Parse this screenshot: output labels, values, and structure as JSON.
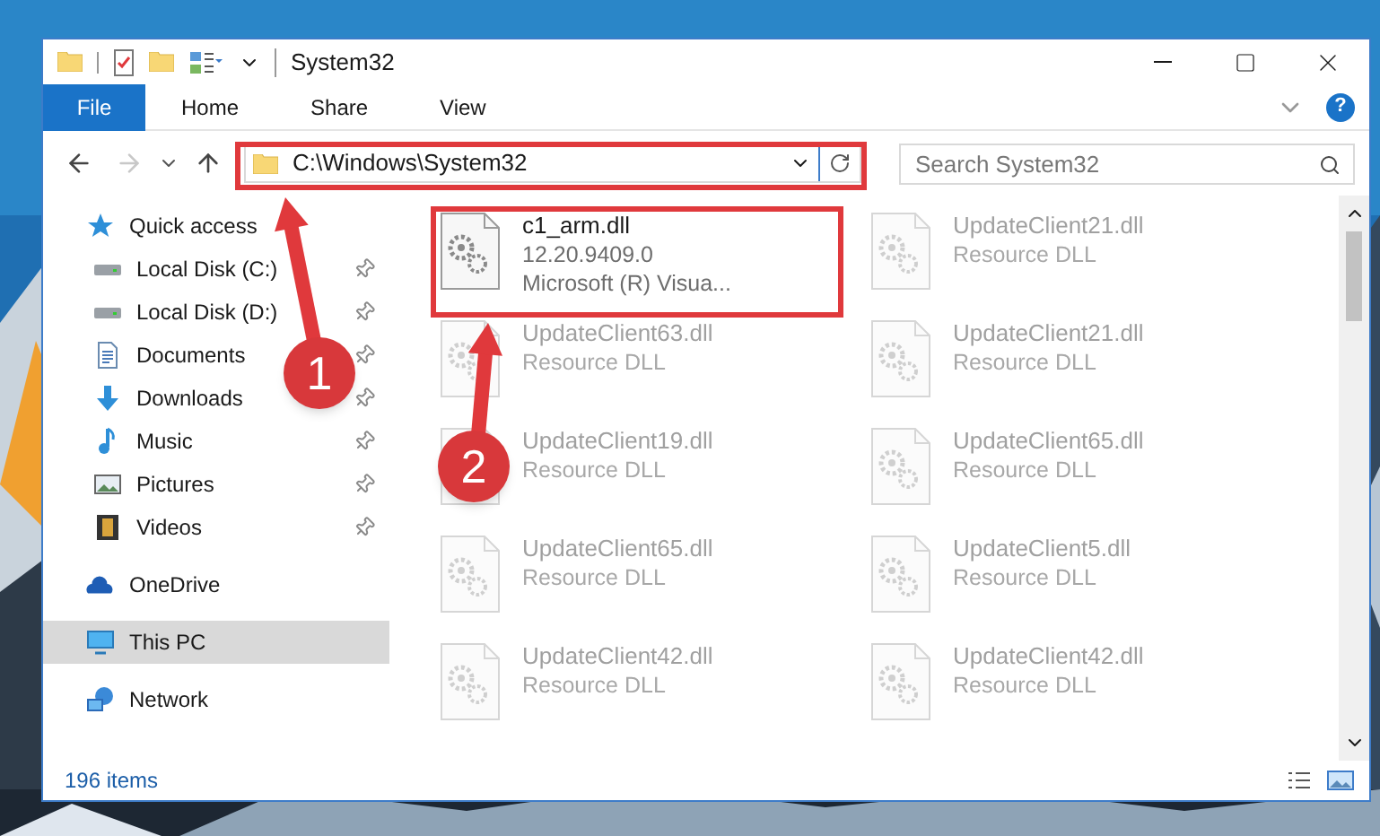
{
  "window": {
    "title": "System32",
    "help": "?"
  },
  "ribbon_tabs": [
    {
      "label": "File",
      "kind": "menu"
    },
    {
      "label": "Home",
      "kind": "tab"
    },
    {
      "label": "Share",
      "kind": "tab"
    },
    {
      "label": "View",
      "kind": "tab"
    }
  ],
  "navigation": {
    "forward_disabled": true
  },
  "address": {
    "path": "C:\\Windows\\System32"
  },
  "search": {
    "placeholder": "Search System32"
  },
  "sidebar": {
    "items": [
      {
        "label": "Quick access",
        "kind": "star",
        "selected": false,
        "children": [
          {
            "label": "Local Disk (C:)",
            "kind": "drive",
            "selected": false,
            "pinned": true
          },
          {
            "label": "Local Disk (D:)",
            "kind": "drive",
            "selected": false,
            "pinned": true
          },
          {
            "label": "Documents",
            "kind": "documents",
            "selected": false,
            "pinned": true
          },
          {
            "label": "Downloads",
            "kind": "downloads",
            "selected": false,
            "pinned": true
          },
          {
            "label": "Music",
            "kind": "music",
            "selected": false,
            "pinned": true
          },
          {
            "label": "Pictures",
            "kind": "pictures",
            "selected": false,
            "pinned": true
          },
          {
            "label": "Videos",
            "kind": "videos",
            "selected": false,
            "pinned": true
          }
        ]
      },
      {
        "label": "OneDrive",
        "kind": "cloud",
        "selected": false
      },
      {
        "label": "This PC",
        "kind": "computer",
        "selected": true
      },
      {
        "label": "Network",
        "kind": "network",
        "selected": false
      }
    ]
  },
  "files": [
    {
      "name": "c1_arm.dll",
      "lines": [
        "12.20.9409.0",
        "Microsoft (R) Visua..."
      ],
      "blurred": false
    },
    {
      "name": "UpdateClient21.dll",
      "lines": [
        "Resource DLL"
      ],
      "blurred": true
    },
    {
      "name": "UpdateClient63.dll",
      "lines": [
        "Resource DLL"
      ],
      "blurred": true
    },
    {
      "name": "UpdateClient21.dll",
      "lines": [
        "Resource DLL"
      ],
      "blurred": true
    },
    {
      "name": "UpdateClient19.dll",
      "lines": [
        "Resource DLL"
      ],
      "blurred": true
    },
    {
      "name": "UpdateClient65.dll",
      "lines": [
        "Resource DLL"
      ],
      "blurred": true
    },
    {
      "name": "UpdateClient65.dll",
      "lines": [
        "Resource DLL"
      ],
      "blurred": true
    },
    {
      "name": "UpdateClient5.dll",
      "lines": [
        "Resource DLL"
      ],
      "blurred": true
    },
    {
      "name": "UpdateClient42.dll",
      "lines": [
        "Resource DLL"
      ],
      "blurred": true
    },
    {
      "name": "UpdateClient42.dll",
      "lines": [
        "Resource DLL"
      ],
      "blurred": true
    }
  ],
  "status_bar": {
    "item_count": "196 items"
  },
  "annotations": [
    {
      "number": "1"
    },
    {
      "number": "2"
    }
  ]
}
